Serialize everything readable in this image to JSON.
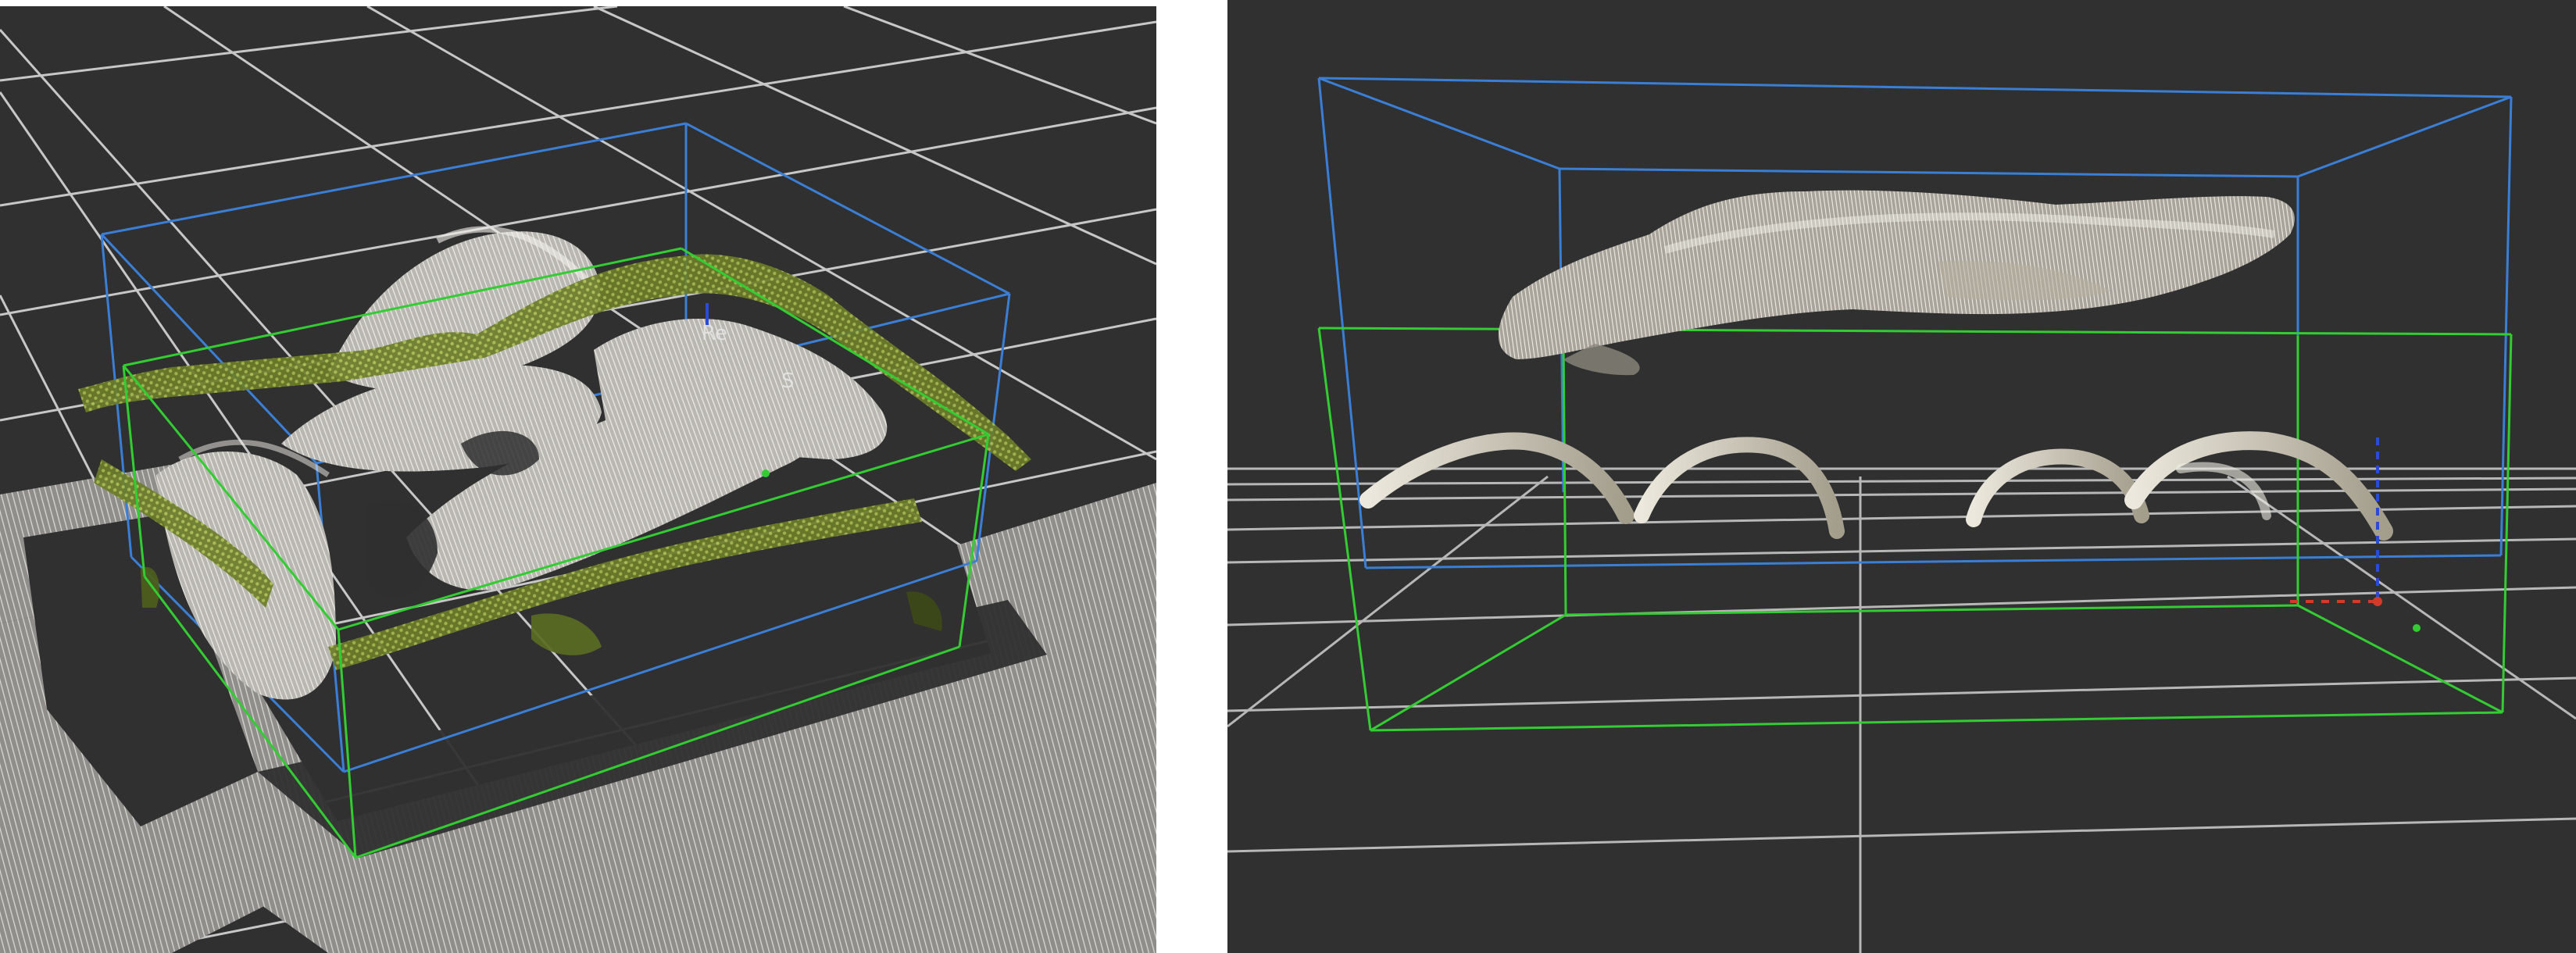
{
  "panels": [
    {
      "id": "left",
      "view": "oblique-3d",
      "frame_labels": [
        "Re",
        "S"
      ]
    },
    {
      "id": "right",
      "view": "side",
      "frame_labels": []
    }
  ],
  "colors": {
    "viewport_background": "#303030",
    "grid": "#d8d8d8",
    "outer_bounding_box": "#3a7fd5",
    "inner_bounding_box": "#33cc33",
    "point_cloud_light": "#e8e4dc",
    "point_cloud_moss": "#8fa83a",
    "axis_x": "#d43a2a",
    "axis_y": "#33cc33",
    "axis_z": "#2a4cd4"
  }
}
